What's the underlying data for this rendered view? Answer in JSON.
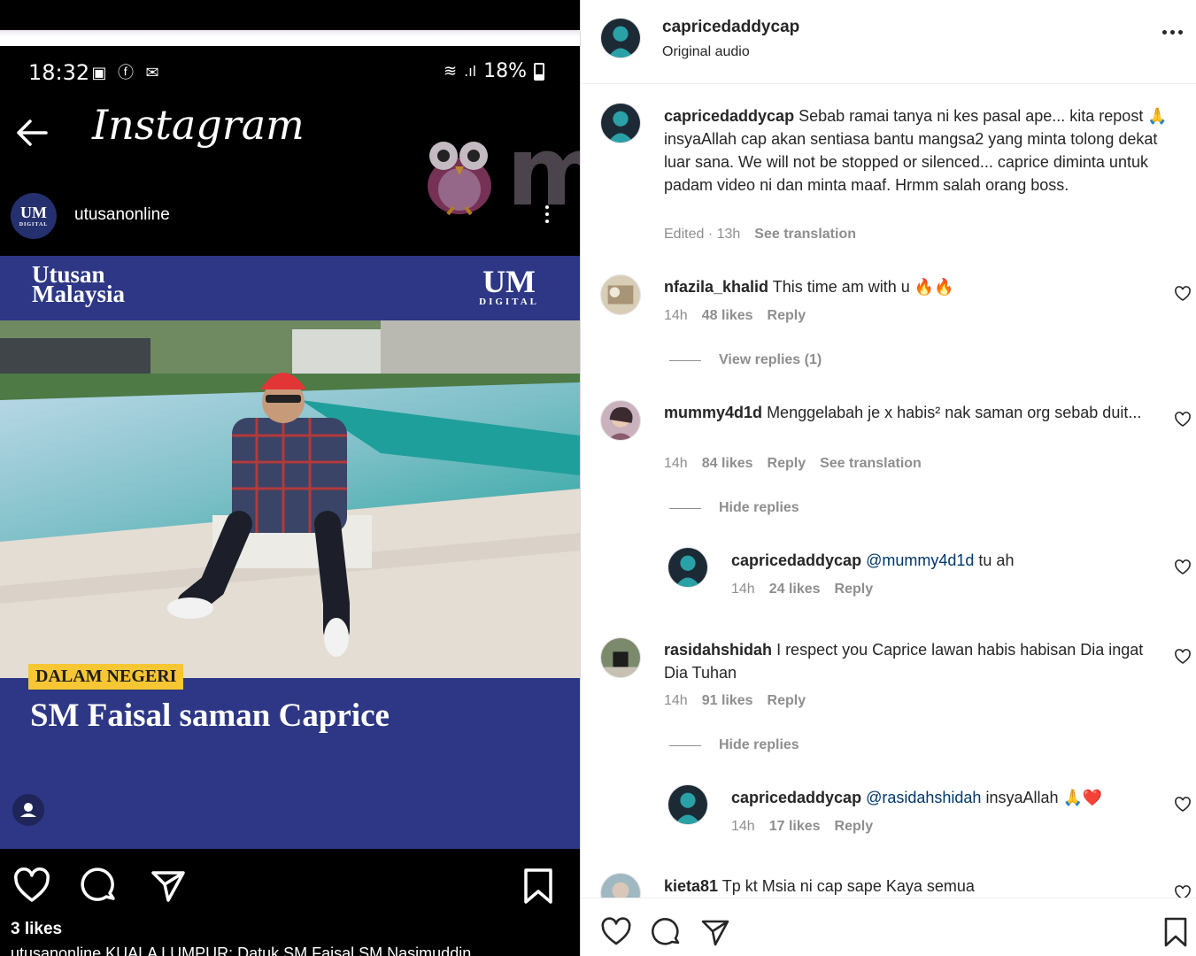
{
  "phone": {
    "time": "18:32",
    "battery": "18%",
    "app_title": "Instagram"
  },
  "post": {
    "username": "utusanonline",
    "avatar_text": "UM",
    "avatar_subtext": "DIGITAL",
    "likes": "3 likes",
    "caption_preview": "utusanonline KUALA LUMPUR: Datuk SM Faisal SM Nasimuddin"
  },
  "news_card": {
    "brand_line1": "Utusan",
    "brand_line2": "Malaysia",
    "logo_big": "UM",
    "logo_small": "DIGITAL",
    "category": "DALAM NEGERI",
    "headline": "SM Faisal saman Caprice"
  },
  "watermark": {
    "text": "mur"
  },
  "panel": {
    "header": {
      "username": "capricedaddycap",
      "subtitle": "Original audio"
    },
    "caption": {
      "username": "capricedaddycap",
      "text": "Sebab ramai tanya ni kes pasal ape... kita repost 🙏 insyaAllah cap akan sentiasa bantu mangsa2 yang minta tolong dekat luar sana. We will not be stopped or silenced... caprice diminta untuk padam video ni dan minta maaf. Hrmm salah orang boss.",
      "edited": "Edited · 13h",
      "see_translation": "See translation"
    },
    "comments": [
      {
        "username": "nfazila_khalid",
        "text": "This time am with u 🔥🔥",
        "time": "14h",
        "likes": "48 likes",
        "reply": "Reply",
        "toggle": "View replies (1)"
      },
      {
        "username": "mummy4d1d",
        "text": "Menggelabah je x habis² nak saman org sebab duit...",
        "time": "14h",
        "likes": "84 likes",
        "reply": "Reply",
        "translation": "See translation",
        "toggle": "Hide replies",
        "reply_item": {
          "username": "capricedaddycap",
          "mention": "@mummy4d1d",
          "text": "tu ah",
          "time": "14h",
          "likes": "24 likes",
          "reply": "Reply"
        }
      },
      {
        "username": "rasidahshidah",
        "text": "I respect you Caprice lawan habis habisan Dia ingat Dia Tuhan",
        "time": "14h",
        "likes": "91 likes",
        "reply": "Reply",
        "toggle": "Hide replies",
        "reply_item": {
          "username": "capricedaddycap",
          "mention": "@rasidahshidah",
          "text": "insyaAllah 🙏❤️",
          "time": "14h",
          "likes": "17 likes",
          "reply": "Reply"
        }
      },
      {
        "username": "kieta81",
        "text": "Tp kt Msia ni cap sape Kaya semua"
      }
    ]
  },
  "colors": {
    "card_blue": "#2d3785",
    "tag_yellow": "#f6c633",
    "mention": "#00376b",
    "muted": "#8e8e8e"
  }
}
